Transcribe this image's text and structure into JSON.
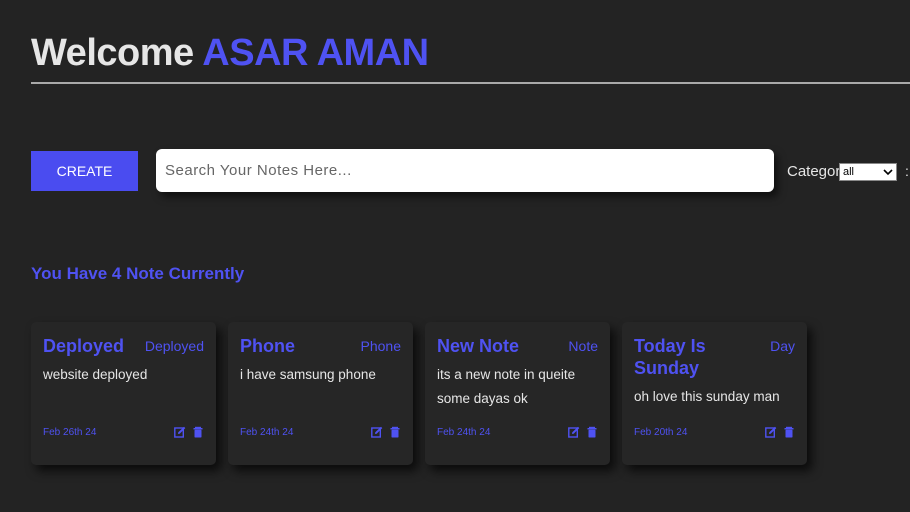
{
  "header": {
    "greeting": "Welcome",
    "username": "ASAR AMAN"
  },
  "toolbar": {
    "create_label": "CREATE",
    "search_placeholder": "Search Your Notes Here...",
    "search_value": "",
    "category_label": "Category",
    "category_selected": "all"
  },
  "notes_heading": "You Have 4 Note Currently",
  "notes": [
    {
      "title": "Deployed",
      "category": "Deployed",
      "body": "website deployed",
      "date": "Feb 26th 24"
    },
    {
      "title": "Phone",
      "category": "Phone",
      "body": "i have samsung phone",
      "date": "Feb 24th 24"
    },
    {
      "title": "New Note",
      "category": "Note",
      "body": "its a new note in queite some dayas ok",
      "date": "Feb 24th 24"
    },
    {
      "title": "Today Is Sunday",
      "category": "Day",
      "body": "oh love this sunday man",
      "date": "Feb 20th 24"
    }
  ],
  "icons": {
    "edit": "edit-icon",
    "delete": "trash-icon",
    "dropdown": "chevron-down-icon"
  },
  "colors": {
    "accent": "#4f52f2",
    "button": "#4a4cf0",
    "background": "#232323",
    "card": "#262626"
  }
}
